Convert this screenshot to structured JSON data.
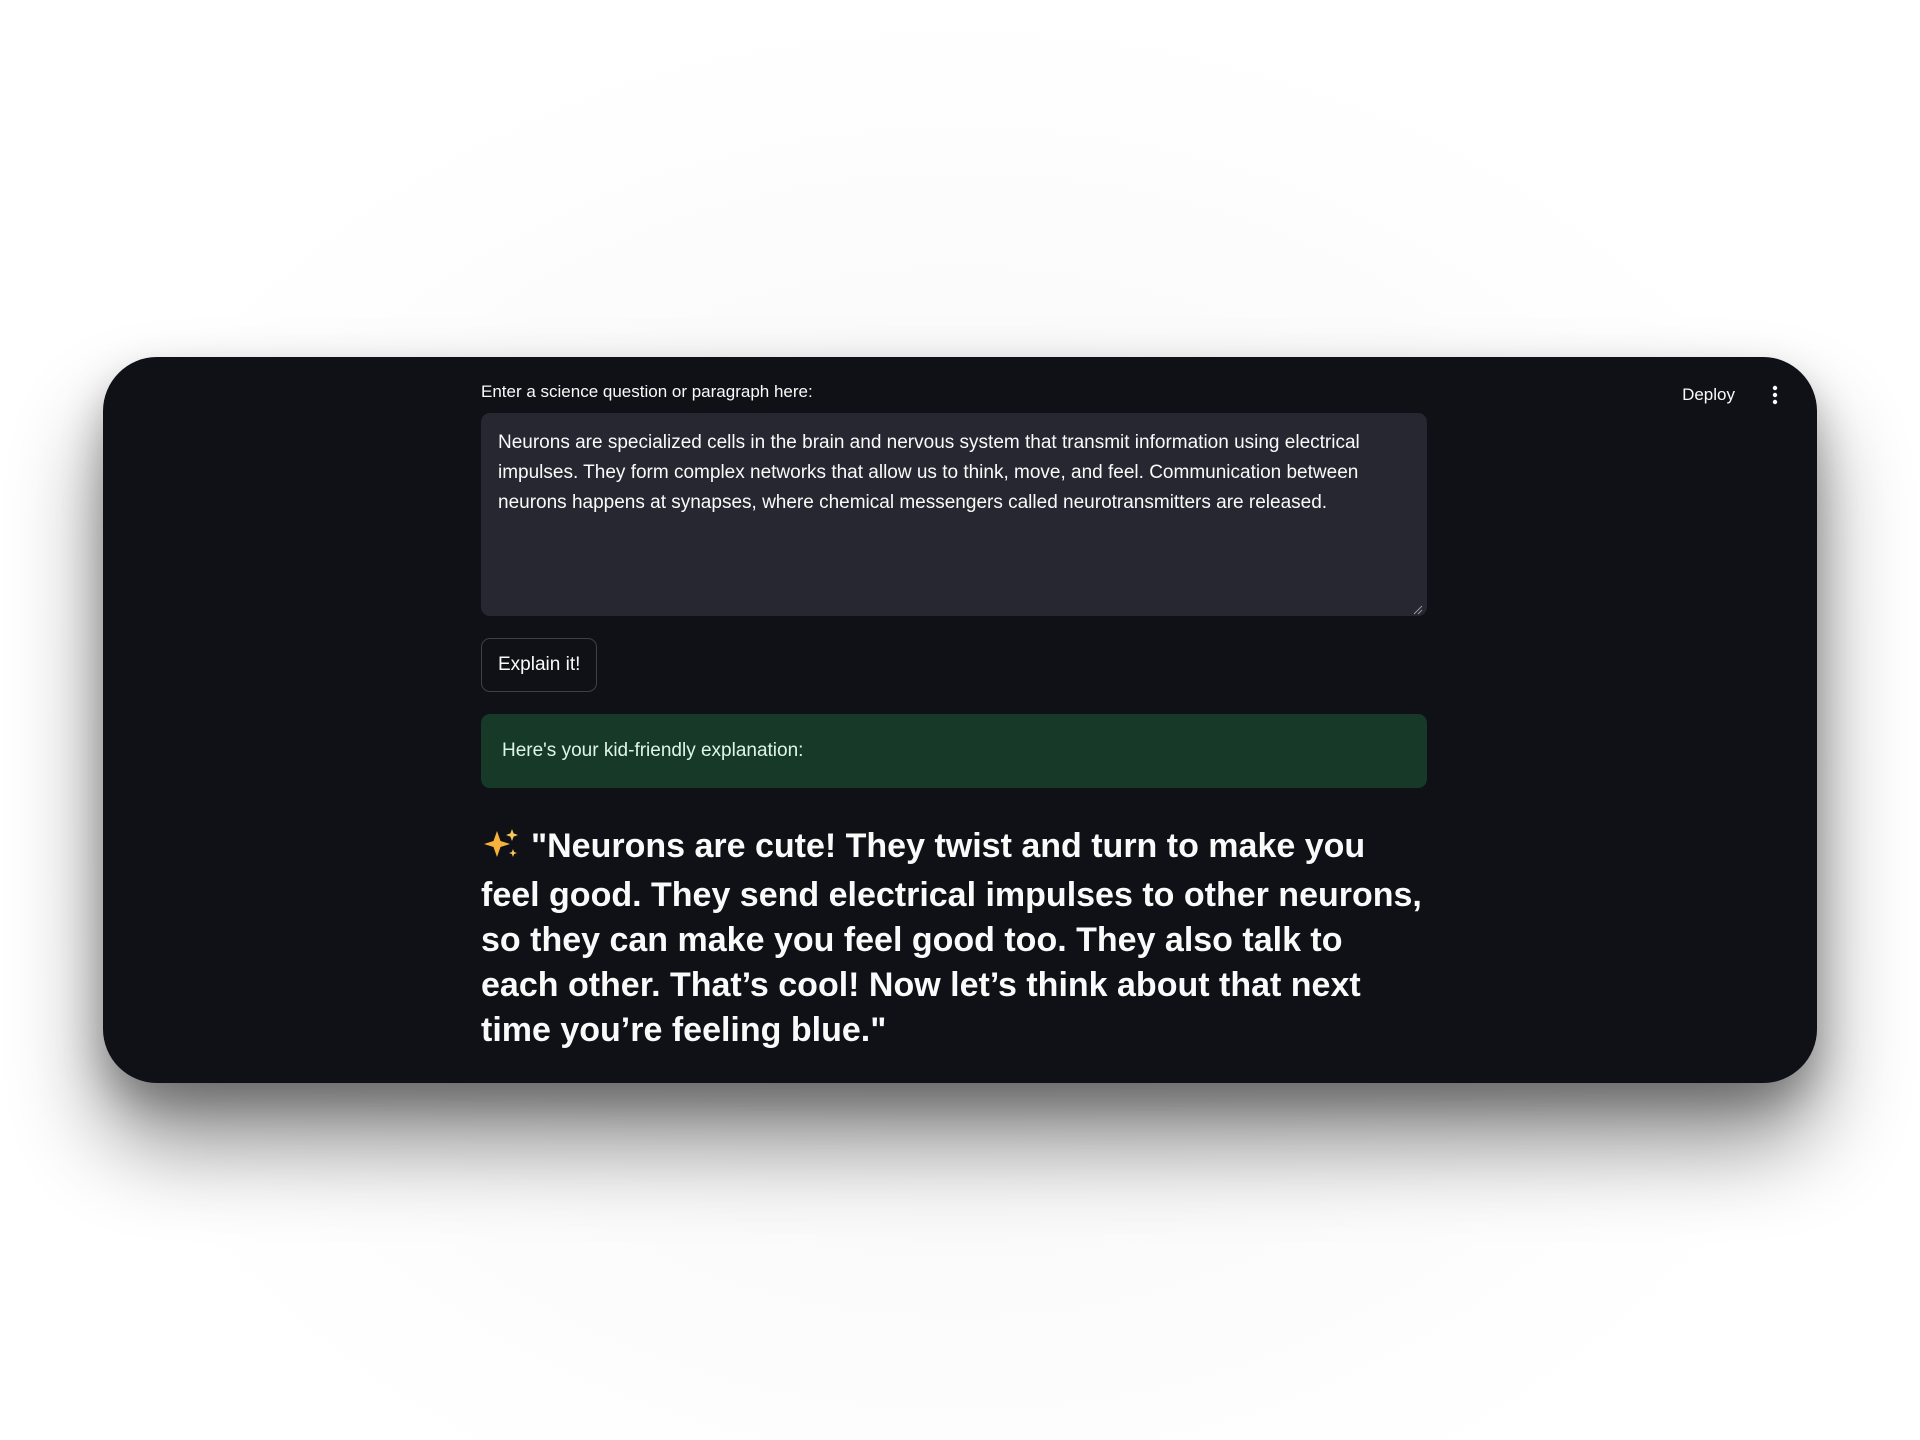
{
  "toolbar": {
    "deploy_label": "Deploy",
    "menu_icon": "more-vertical-icon"
  },
  "form": {
    "label": "Enter a science question or paragraph here:",
    "textarea_value": "Neurons are specialized cells in the brain and nervous system that transmit information using electrical impulses. They form complex networks that allow us to think, move, and feel. Communication between neurons happens at synapses, where chemical messengers called neurotransmitters are released.",
    "button_label": "Explain it!"
  },
  "result": {
    "success_message": "Here's your kid-friendly explanation:",
    "sparkle_icon": "sparkles-icon",
    "explanation_text": "\"Neurons are cute! They twist and turn to make you feel good. They send electrical impulses to other neurons, so they can make you feel good too. They also talk to each other. That’s cool! Now let’s think about that next time you’re feeling blue.\""
  },
  "colors": {
    "app_background": "#0f1117",
    "textarea_background": "#262730",
    "success_background": "#173928",
    "text": "#fafafa"
  }
}
